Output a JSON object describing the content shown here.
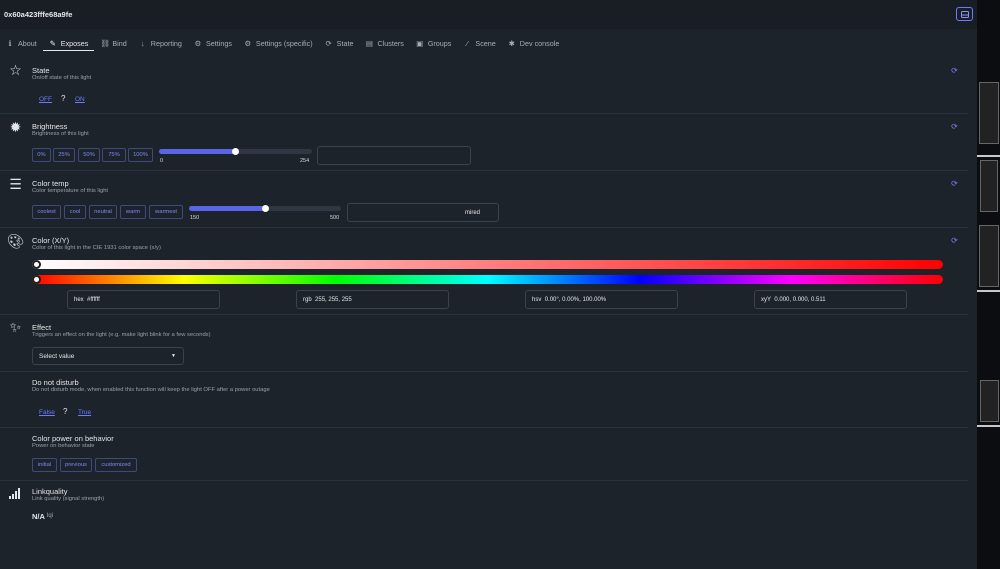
{
  "header": {
    "title": "0x60a423fffe68a9fe",
    "action_icon": "tray-icon"
  },
  "tabs": [
    {
      "label": "About",
      "icon": "info"
    },
    {
      "label": "Exposes",
      "icon": "wand",
      "active": true
    },
    {
      "label": "Bind",
      "icon": "link"
    },
    {
      "label": "Reporting",
      "icon": "download"
    },
    {
      "label": "Settings",
      "icon": "cogs"
    },
    {
      "label": "Settings (specific)",
      "icon": "cog"
    },
    {
      "label": "State",
      "icon": "sync"
    },
    {
      "label": "Clusters",
      "icon": "clipboard"
    },
    {
      "label": "Groups",
      "icon": "object-group"
    },
    {
      "label": "Scene",
      "icon": "magic"
    },
    {
      "label": "Dev console",
      "icon": "bug"
    }
  ],
  "state": {
    "name": "State",
    "desc": "On/off state of this light",
    "off": "OFF",
    "sep": "?",
    "on": "ON"
  },
  "brightness": {
    "name": "Brightness",
    "desc": "Brightness of this light",
    "presets": [
      "0%",
      "25%",
      "50%",
      "75%",
      "100%"
    ],
    "min": "0",
    "max": "254",
    "value": "",
    "level_fraction": 0.5
  },
  "color_temp": {
    "name": "Color temp",
    "desc": "Color temperature of this light",
    "presets": [
      "coolest",
      "cool",
      "neutral",
      "warm",
      "warmest"
    ],
    "min": "150",
    "max": "500",
    "unit": "mired",
    "level_fraction": 0.5
  },
  "color": {
    "name": "Color (X/Y)",
    "desc": "Color of this light in the CIE 1931 color space (x/y)",
    "hex_label": "hex",
    "hex_value": "#ffffff",
    "rgb_label": "rgb",
    "rgb_value": "255, 255, 255",
    "hsv_label": "hsv",
    "hsv_value": "0.00°, 0.00%, 100.00%",
    "xyy_label": "xyY",
    "xyy_value": "0.000, 0.000, 0.511"
  },
  "effect": {
    "name": "Effect",
    "desc": "Triggers an effect on the light (e.g. make light blink for a few seconds)",
    "placeholder": "Select value"
  },
  "dnd": {
    "name": "Do not disturb",
    "desc": "Do not disturb mode, when enabled this function will keep the light OFF after a power outage",
    "off": "False",
    "sep": "?",
    "on": "True"
  },
  "power_on": {
    "name": "Color power on behavior",
    "desc": "Power on behavior state",
    "options": [
      "initial",
      "previous",
      "customized"
    ]
  },
  "linkquality": {
    "name": "Linkquality",
    "desc": "Link quality (signal strength)",
    "value": "N/A",
    "unit": "lqi"
  }
}
